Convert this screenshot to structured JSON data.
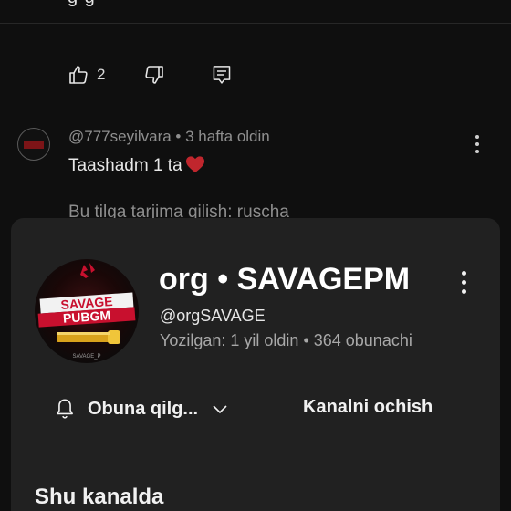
{
  "top": {
    "cut_text": "g   g"
  },
  "actions": {
    "like_count": "2"
  },
  "comment": {
    "author": "@777seyilvara",
    "separator": " • ",
    "time": "3 hafta oldin",
    "text": "Taashadm 1 ta",
    "translate_label": "Bu tilga tarjima qilish: ruscha"
  },
  "channel_sheet": {
    "avatar": {
      "line1": "SAVAGE",
      "line2": "PUBGM",
      "small_text": "SAVAGE_P"
    },
    "name": "org • SAVAGEPM",
    "handle": "@orgSAVAGE",
    "stats": "Yozilgan: 1 yil oldin • 364 obunachi",
    "subscribe_label": "Obuna qilg...",
    "open_channel_label": "Kanalni ochish",
    "section_title": "Shu kanalda"
  },
  "colors": {
    "background": "#0f0f0f",
    "sheet": "#212121",
    "heart": "#c0262d",
    "brand_red": "#c8102e"
  },
  "icons": [
    "like-icon",
    "dislike-icon",
    "reply-icon",
    "heart-icon",
    "more-vert-icon",
    "bell-icon",
    "chevron-down-icon"
  ]
}
